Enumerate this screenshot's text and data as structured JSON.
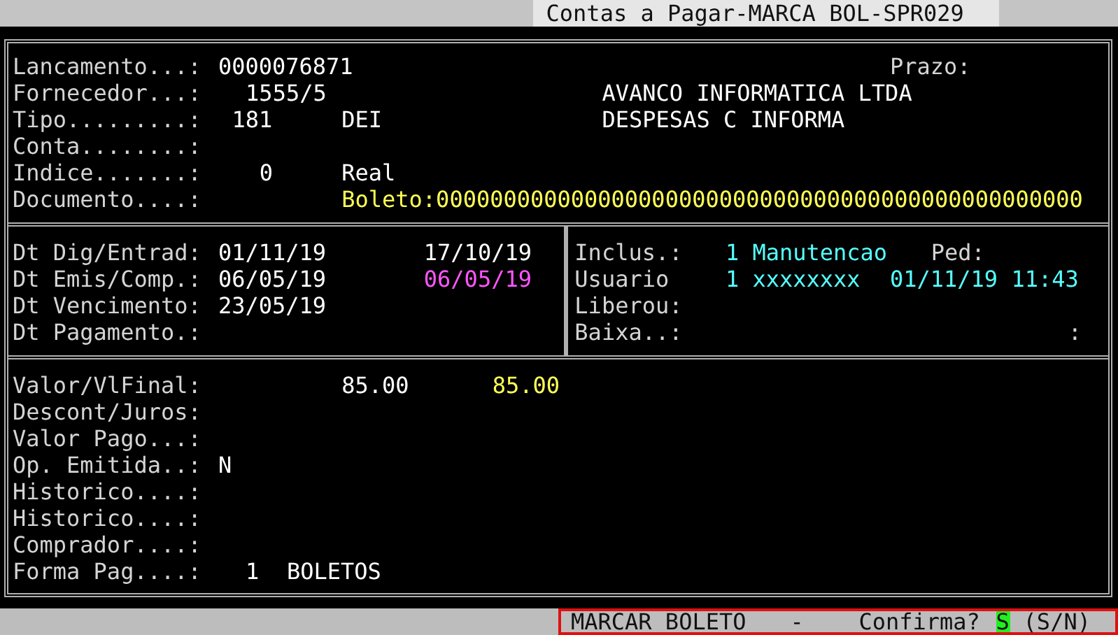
{
  "window": {
    "title": "Contas a Pagar-MARCA BOL-SPR029"
  },
  "header": {
    "rows": [
      {
        "fields": [
          {
            "label": "Lancamento...:",
            "values": [
              {
                "text": "0000076871",
                "color": "#ffffff"
              }
            ]
          },
          {
            "label": "Prazo:"
          }
        ]
      },
      {
        "fields": [
          {
            "label": "Fornecedor...:",
            "values": [
              {
                "text": "1555/5",
                "color": "#ffffff"
              },
              {
                "text": "AVANCO INFORMATICA LTDA",
                "color": "#ffffff"
              }
            ]
          }
        ]
      },
      {
        "fields": [
          {
            "label": "Tipo.........:",
            "values": [
              {
                "text": "181",
                "color": "#ffffff"
              },
              {
                "text": "DEI",
                "color": "#ffffff"
              },
              {
                "text": "DESPESAS C INFORMA",
                "color": "#ffffff"
              }
            ]
          }
        ]
      },
      {
        "fields": [
          {
            "label": "Conta........:"
          }
        ]
      },
      {
        "fields": [
          {
            "label": "Indice.......:",
            "values": [
              {
                "text": "0",
                "color": "#ffffff"
              },
              {
                "text": "Real",
                "color": "#ffffff"
              }
            ]
          }
        ]
      },
      {
        "fields": [
          {
            "label": "Documento....:",
            "values": [
              {
                "text": "Boleto:000000000000000000000000000000000000000000000000",
                "color": "#ffff55"
              }
            ]
          }
        ]
      }
    ]
  },
  "dates": {
    "rows": [
      {
        "fields": [
          {
            "label": "Dt Dig/Entrad:",
            "values": [
              {
                "text": "01/11/19",
                "color": "#ffffff"
              },
              {
                "text": "17/10/19",
                "color": "#ffffff"
              }
            ]
          },
          {
            "label": "Inclus.:",
            "values": [
              {
                "text": "1 Manutencao",
                "color": "#55ffff"
              }
            ]
          },
          {
            "label": "Ped:"
          }
        ]
      },
      {
        "fields": [
          {
            "label": "Dt Emis/Comp.:",
            "values": [
              {
                "text": "06/05/19",
                "color": "#ffffff"
              },
              {
                "text": "06/05/19",
                "color": "#ff55ff"
              }
            ]
          },
          {
            "label": "Usuario",
            "values": [
              {
                "text": "1 xxxxxxxx",
                "color": "#55ffff"
              },
              {
                "text": "01/11/19 11:43",
                "color": "#55ffff"
              }
            ]
          }
        ]
      },
      {
        "fields": [
          {
            "label": "Dt Vencimento:",
            "values": [
              {
                "text": "23/05/19",
                "color": "#ffffff"
              }
            ]
          },
          {
            "label": "Liberou:"
          }
        ]
      },
      {
        "fields": [
          {
            "label": "Dt Pagamento.:"
          },
          {
            "label": "Baixa..:"
          },
          {
            "label": ":"
          }
        ]
      }
    ]
  },
  "values": {
    "rows": [
      {
        "fields": [
          {
            "label": "Valor/VlFinal:",
            "values": [
              {
                "text": "85.00",
                "color": "#ffffff"
              },
              {
                "text": "85.00",
                "color": "#ffff55"
              }
            ]
          }
        ]
      },
      {
        "fields": [
          {
            "label": "Descont/Juros:"
          }
        ]
      },
      {
        "fields": [
          {
            "label": "Valor Pago...:"
          }
        ]
      },
      {
        "fields": [
          {
            "label": "Op. Emitida..:",
            "values": [
              {
                "text": "N",
                "color": "#ffffff"
              }
            ]
          }
        ]
      },
      {
        "fields": [
          {
            "label": "Historico....:"
          }
        ]
      },
      {
        "fields": [
          {
            "label": "Historico....:"
          }
        ]
      },
      {
        "fields": [
          {
            "label": "Comprador....:"
          }
        ]
      },
      {
        "fields": [
          {
            "label": "Forma Pag....:",
            "values": [
              {
                "text": "1",
                "color": "#ffffff"
              },
              {
                "text": "BOLETOS",
                "color": "#ffffff"
              }
            ]
          }
        ]
      }
    ]
  },
  "status_bar": {
    "message": "MARCAR BOLETO",
    "separator": "-",
    "prompt": "Confirma?",
    "answer": "S",
    "options": "(S/N)"
  }
}
